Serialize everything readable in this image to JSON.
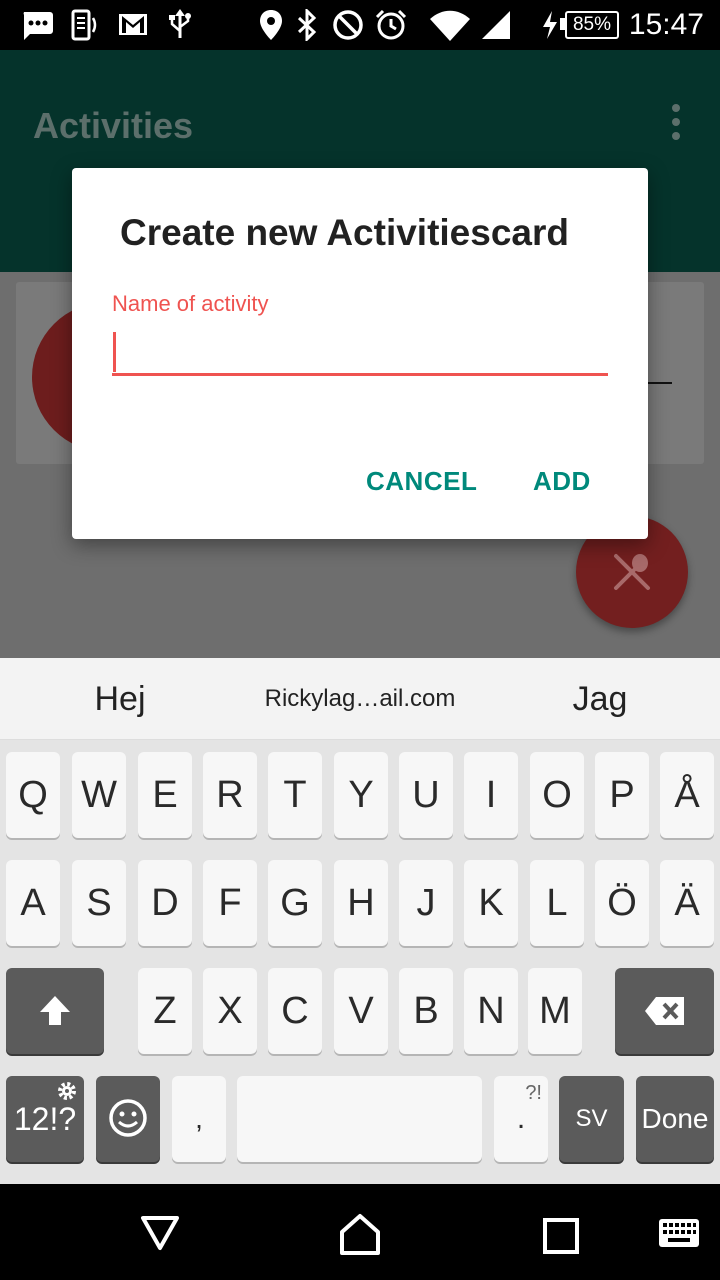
{
  "status_bar": {
    "time": "15:47",
    "battery": "85%",
    "icons": [
      "chat-icon",
      "vibrate-icon",
      "gmail-icon",
      "usb-icon",
      "location-icon",
      "bluetooth-icon",
      "do-not-disturb-icon",
      "alarm-icon",
      "wifi-icon",
      "signal-icon",
      "charging-icon"
    ]
  },
  "app_bar": {
    "title": "Activities",
    "overflow_icon": "more-vert-icon"
  },
  "dialog": {
    "title": "Create new Activitiescard",
    "field_label": "Name of activity",
    "field_value": "",
    "cancel_label": "CANCEL",
    "add_label": "ADD",
    "accent_color": "#ef5350",
    "button_color": "#00897b"
  },
  "fab": {
    "icon": "restaurant-icon"
  },
  "suggestions": [
    "Hej",
    "Rickylag…ail.com",
    "Jag"
  ],
  "keyboard": {
    "row1": [
      "Q",
      "W",
      "E",
      "R",
      "T",
      "Y",
      "U",
      "I",
      "O",
      "P",
      "Å"
    ],
    "row2": [
      "A",
      "S",
      "D",
      "F",
      "G",
      "H",
      "J",
      "K",
      "L",
      "Ö",
      "Ä"
    ],
    "row3": [
      "Z",
      "X",
      "C",
      "V",
      "B",
      "N",
      "M"
    ],
    "symbols_label": "12!?",
    "comma": ",",
    "period": ".",
    "period_sub": "?!",
    "language": "SV",
    "done_label": "Done"
  }
}
